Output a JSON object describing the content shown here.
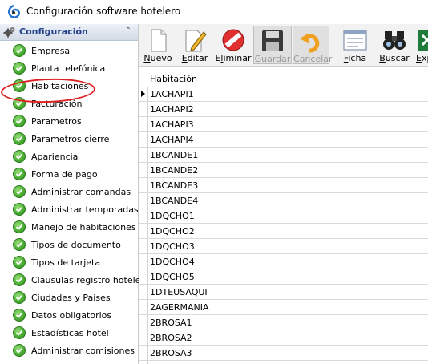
{
  "window": {
    "title": "Configuración software hotelero"
  },
  "sidebar": {
    "header": "Configuración",
    "collapse_glyph": "⌃",
    "items": [
      {
        "label": "Empresa"
      },
      {
        "label": "Planta telefónica"
      },
      {
        "label": "Habitaciones"
      },
      {
        "label": "Facturación"
      },
      {
        "label": "Parametros"
      },
      {
        "label": "Parametros cierre"
      },
      {
        "label": "Apariencia"
      },
      {
        "label": "Forma de pago"
      },
      {
        "label": "Administrar comandas"
      },
      {
        "label": "Administrar temporadas"
      },
      {
        "label": "Manejo de habitaciones"
      },
      {
        "label": "Tipos de documento"
      },
      {
        "label": "Tipos de tarjeta"
      },
      {
        "label": "Clausulas registro hotelero"
      },
      {
        "label": "Ciudades y Paises"
      },
      {
        "label": "Datos obligatorios"
      },
      {
        "label": "Estadísticas hotel"
      },
      {
        "label": "Administrar comisiones"
      }
    ]
  },
  "toolbar": {
    "nuevo": {
      "mnemonic": "N",
      "rest": "uevo"
    },
    "editar": {
      "mnemonic": "E",
      "rest": "ditar"
    },
    "eliminar": {
      "pre": "E",
      "mnemonic": "l",
      "rest": "iminar"
    },
    "guardar": {
      "mnemonic": "G",
      "rest": "uardar"
    },
    "cancelar": {
      "mnemonic": "C",
      "rest": "ancelar"
    },
    "ficha": {
      "mnemonic": "F",
      "rest": "icha"
    },
    "buscar": {
      "mnemonic": "B",
      "rest": "uscar"
    },
    "exportar": {
      "mnemonic": "E",
      "rest": "xp"
    }
  },
  "grid": {
    "column": "Habitación",
    "rows": [
      "1ACHAPI1",
      "1ACHAPI2",
      "1ACHAPI3",
      "1ACHAPI4",
      "1BCANDE1",
      "1BCANDE2",
      "1BCANDE3",
      "1BCANDE4",
      "1DQCHO1",
      "1DQCHO2",
      "1DQCHO3",
      "1DQCHO4",
      "1DQCHO5",
      "1DTEUSAQUI",
      "2AGERMANIA",
      "2BROSA1",
      "2BROSA2",
      "2BROSA3"
    ]
  }
}
